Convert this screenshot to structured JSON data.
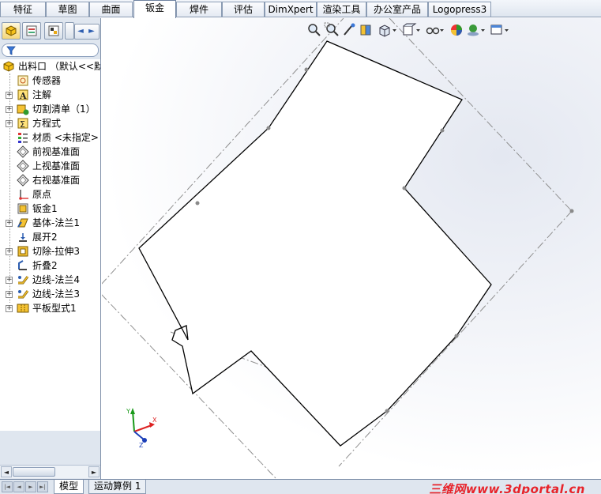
{
  "tabs": [
    "特征",
    "草图",
    "曲面",
    "钣金",
    "焊件",
    "评估",
    "DimXpert",
    "渲染工具",
    "办公室产品",
    "Logopress3"
  ],
  "active_tab": "钣金",
  "panel": {
    "nav_left": "◄",
    "nav_right": "►",
    "tree": [
      {
        "label": "出料口 （默认<<默",
        "icon": "part-icon",
        "expander": false,
        "root": true
      },
      {
        "label": "传感器",
        "icon": "sensor-icon",
        "expander": false
      },
      {
        "label": "注解",
        "icon": "annotation-icon",
        "expander": true
      },
      {
        "label": "切割清单（1）",
        "icon": "cut-list-icon",
        "expander": true
      },
      {
        "label": "方程式",
        "icon": "equation-icon",
        "expander": true
      },
      {
        "label": "材质 <未指定>",
        "icon": "material-icon",
        "expander": false
      },
      {
        "label": "前视基准面",
        "icon": "plane-icon",
        "expander": false
      },
      {
        "label": "上视基准面",
        "icon": "plane-icon",
        "expander": false
      },
      {
        "label": "右视基准面",
        "icon": "plane-icon",
        "expander": false
      },
      {
        "label": "原点",
        "icon": "origin-icon",
        "expander": false
      },
      {
        "label": "钣金1",
        "icon": "sheet-metal-icon",
        "expander": false
      },
      {
        "label": "基体-法兰1",
        "icon": "base-flange-icon",
        "expander": true
      },
      {
        "label": "展开2",
        "icon": "unfold-icon",
        "expander": false
      },
      {
        "label": "切除-拉伸3",
        "icon": "cut-extrude-icon",
        "expander": true
      },
      {
        "label": "折叠2",
        "icon": "fold-icon",
        "expander": false
      },
      {
        "label": "边线-法兰4",
        "icon": "edge-flange-icon",
        "expander": true
      },
      {
        "label": "边线-法兰3",
        "icon": "edge-flange-icon",
        "expander": true
      },
      {
        "label": "平板型式1",
        "icon": "flat-pattern-icon",
        "expander": true
      }
    ]
  },
  "bottom_tabs": [
    "模型",
    "运动算例 1"
  ],
  "watermark": "三维网www.3dportal.cn",
  "colors": {
    "accent": "#2c5db0",
    "watermark": "#e8232a",
    "axis_x": "#d22",
    "axis_y": "#1a9a1a",
    "axis_z": "#1b3fb8"
  }
}
